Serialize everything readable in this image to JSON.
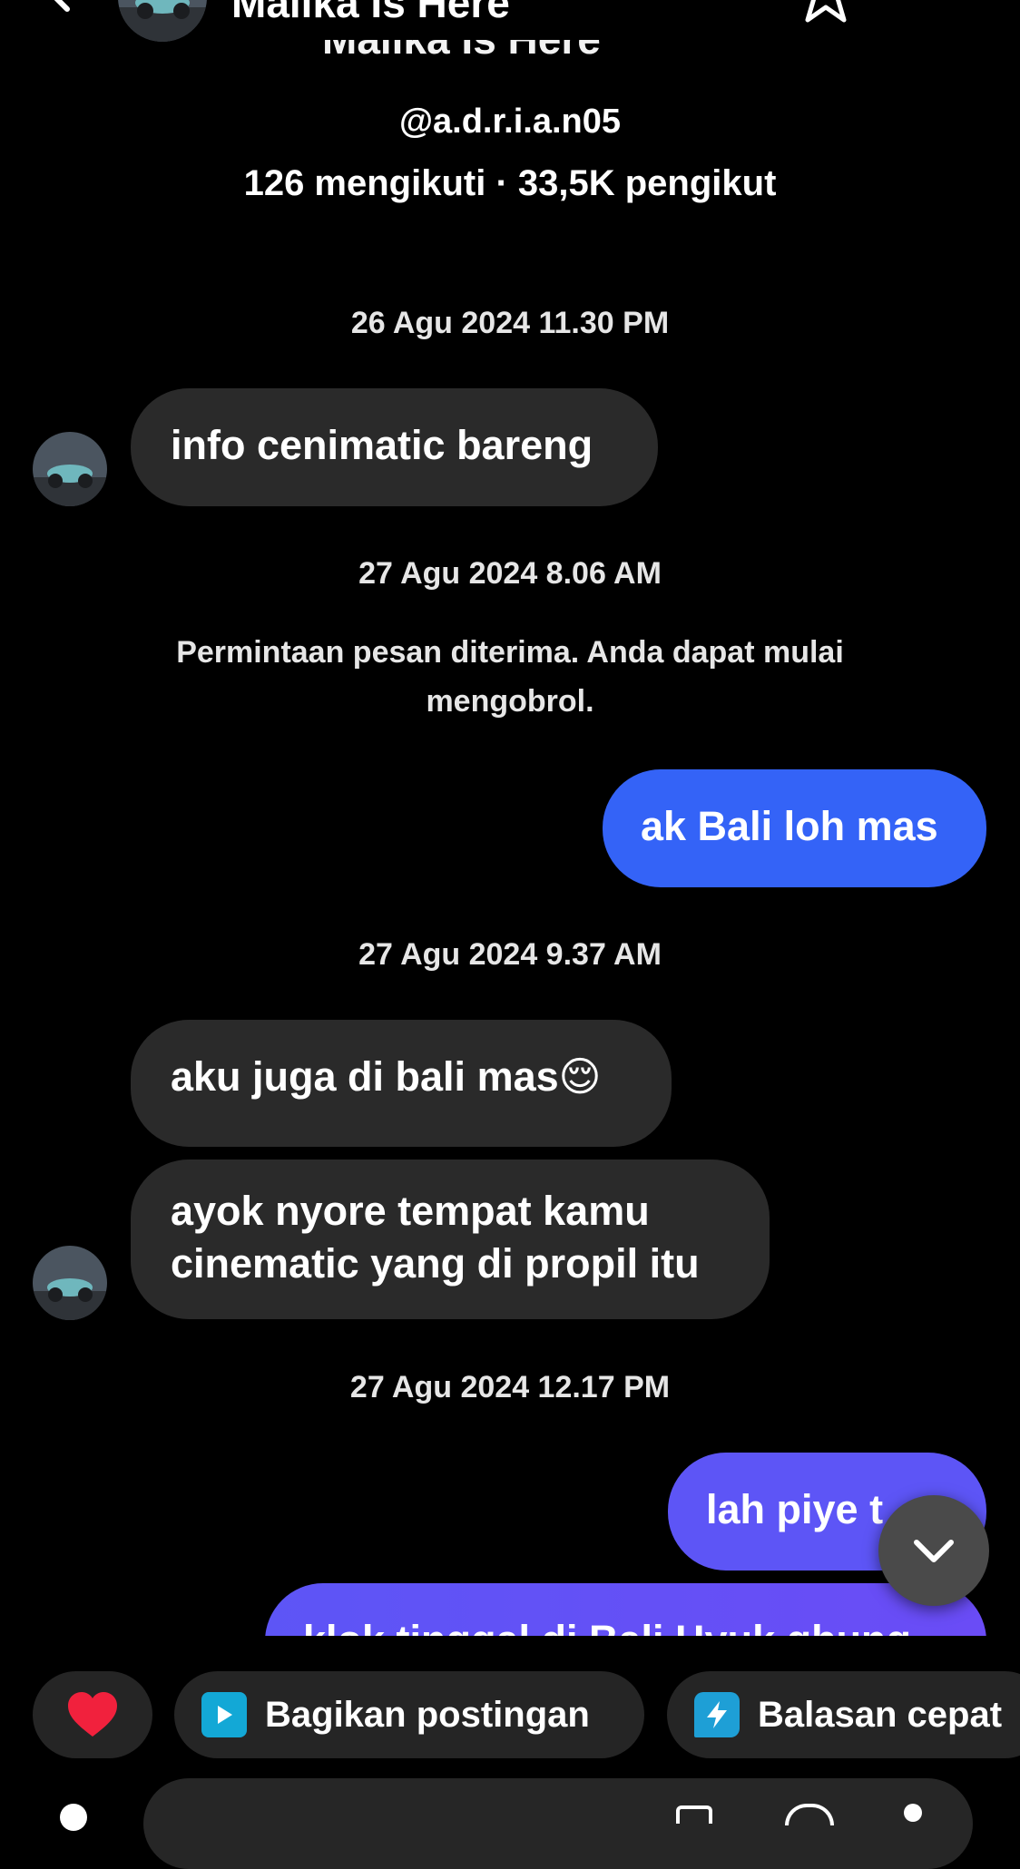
{
  "header": {
    "title": "Malika Is Here",
    "back_icon": "chevron-left-icon",
    "star_icon": "star-icon",
    "more_icon": "ellipsis-icon"
  },
  "profile": {
    "display_name": "Malika Is Here",
    "handle": "@a.d.r.i.a.n05",
    "stats": "126 mengikuti · 33,5K pengikut"
  },
  "messages": {
    "ts1": "26 Agu 2024 11.30 PM",
    "in1": "info cenimatic bareng",
    "ts2": "27 Agu 2024 8.06 AM",
    "system": "Permintaan pesan diterima. Anda dapat mulai mengobrol.",
    "out1": "ak Bali loh mas",
    "ts3": "27 Agu 2024 9.37 AM",
    "in2": "aku juga di bali mas😌",
    "in3_line1": "ayok nyore tempat kamu",
    "in3_line2": "cinematic yang di propil itu",
    "ts4": "27 Agu 2024 12.17 PM",
    "out2": "lah piye t",
    "out3": "klok tinggal di Bali Hyuk gbung"
  },
  "quick_actions": {
    "heart_icon": "heart-icon",
    "share_post": "Bagikan postingan",
    "quick_reply": "Balasan cepat"
  },
  "colors": {
    "background": "#000000",
    "incoming_bubble": "#2a2a2a",
    "outgoing_blue": "#3463f7",
    "outgoing_violet": "#5d55f6",
    "share_icon_bg": "#13a8d6",
    "quick_reply_icon_bg": "#1e9fd6",
    "heart": "#f1213d"
  }
}
